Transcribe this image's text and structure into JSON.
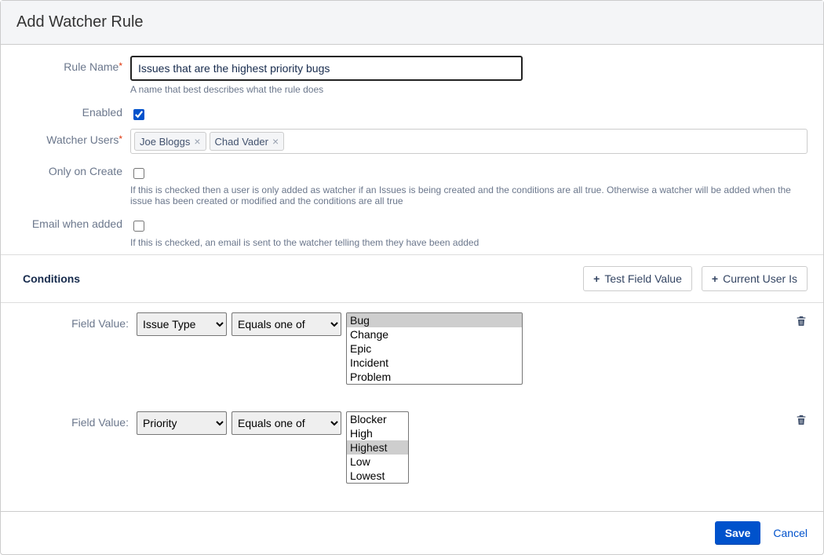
{
  "dialog": {
    "title": "Add Watcher Rule",
    "save_label": "Save",
    "cancel_label": "Cancel"
  },
  "form": {
    "rule_name": {
      "label": "Rule Name",
      "value": "Issues that are the highest priority bugs",
      "help": "A name that best describes what the rule does"
    },
    "enabled": {
      "label": "Enabled",
      "checked": true
    },
    "watcher_users": {
      "label": "Watcher Users",
      "users": [
        "Joe Bloggs",
        "Chad Vader"
      ]
    },
    "only_on_create": {
      "label": "Only on Create",
      "checked": false,
      "help": "If this is checked then a user is only added as watcher if an Issues is being created and the conditions are all true. Otherwise a watcher will be added when the issue has been created or modified and the conditions are all true"
    },
    "email_when_added": {
      "label": "Email when added",
      "checked": false,
      "help": "If this is checked, an email is sent to the watcher telling them they have been added"
    }
  },
  "conditions": {
    "title": "Conditions",
    "test_field_value_label": "Test Field Value",
    "current_user_is_label": "Current User Is",
    "row_label": "Field Value:",
    "rows": [
      {
        "field": "Issue Type",
        "operator": "Equals one of",
        "options": [
          "Bug",
          "Change",
          "Epic",
          "Incident",
          "Problem"
        ],
        "selected": [
          "Bug"
        ]
      },
      {
        "field": "Priority",
        "operator": "Equals one of",
        "options": [
          "Blocker",
          "High",
          "Highest",
          "Low",
          "Lowest"
        ],
        "selected": [
          "Highest"
        ]
      }
    ]
  },
  "field_options": [
    "Issue Type",
    "Priority"
  ],
  "operator_options": [
    "Equals one of"
  ]
}
